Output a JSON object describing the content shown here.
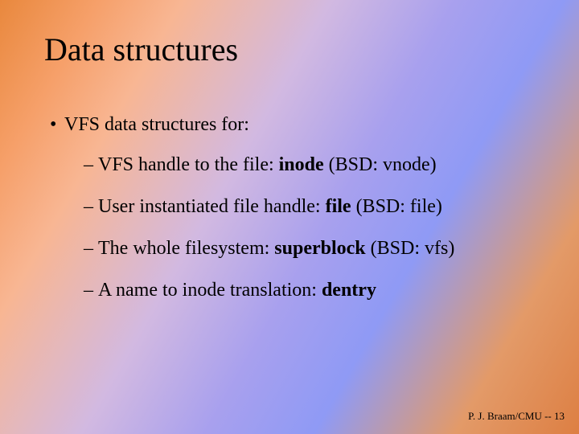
{
  "title": "Data structures",
  "bullet1": {
    "marker": "•",
    "text": "VFS data structures for:"
  },
  "sub": [
    {
      "marker": "–",
      "pre": "VFS handle to the file: ",
      "bold": "inode",
      "post": " (BSD: vnode)"
    },
    {
      "marker": "–",
      "pre": "User instantiated file handle: ",
      "bold": "file",
      "post": " (BSD: file)"
    },
    {
      "marker": "–",
      "pre": "The whole filesystem: ",
      "bold": "superblock",
      "post": " (BSD: vfs)"
    },
    {
      "marker": "–",
      "pre": "A name to inode translation: ",
      "bold": "dentry",
      "post": ""
    }
  ],
  "footer": "P. J. Braam/CMU  -- 13"
}
